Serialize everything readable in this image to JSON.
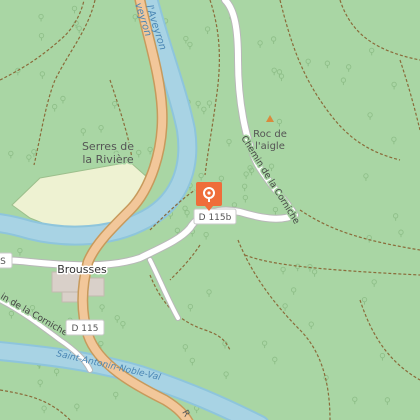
{
  "map": {
    "colors": {
      "forest": "#a9d6a4",
      "meadow": "#eef2d2",
      "river": "#a8d3e4",
      "river_edge": "#8ec5dc",
      "major_road": "#f2c79a",
      "major_road_edge": "#c79a5c",
      "minor_road": "#ffffff",
      "minor_road_edge": "#b8b8b8",
      "track": "#8a6b3a",
      "marker": "#ef6d3a"
    },
    "labels": {
      "river_upper": "l'Aveyron",
      "river_upper_cut": "veyron",
      "river_lower": "Saint-Antonin-Noble-Val",
      "locality_1": "Serres de",
      "locality_2": "la Rivière",
      "village": "Brousses",
      "peak_1": "Roc de",
      "peak_2": "l'aigle",
      "road_corniche_upper": "Chemin de la Corniche",
      "road_corniche_lower": "in de la Corniche",
      "shield_d115b": "D 115b",
      "shield_d115": "D 115",
      "edge_left": "S",
      "edge_bottom": "R"
    },
    "icons": {
      "marker": "map-pin-icon",
      "peak": "peak-icon",
      "trees": "tree-icon"
    }
  }
}
